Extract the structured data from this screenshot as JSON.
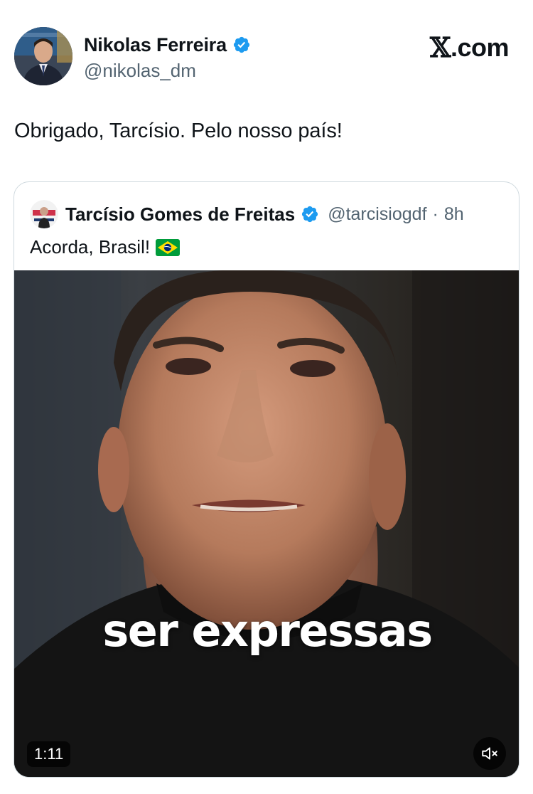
{
  "author": {
    "name": "Nikolas Ferreira",
    "handle": "@nikolas_dm"
  },
  "brand": {
    "x": "𝕏",
    "suffix": ".com"
  },
  "tweet": {
    "text": "Obrigado, Tarcísio. Pelo nosso país!"
  },
  "quoted_tweet": {
    "author_name": "Tarcísio Gomes de Freitas",
    "author_handle": "@tarcisiogdf",
    "separator": "·",
    "time": "8h",
    "text": "Acorda, Brasil!",
    "media": {
      "caption": "ser expressas",
      "duration": "1:11",
      "mute_icon": "speaker-muted-icon"
    }
  },
  "colors": {
    "verified_blue": "#1d9bf0",
    "secondary_text": "#536471",
    "border": "#cfd9de"
  }
}
